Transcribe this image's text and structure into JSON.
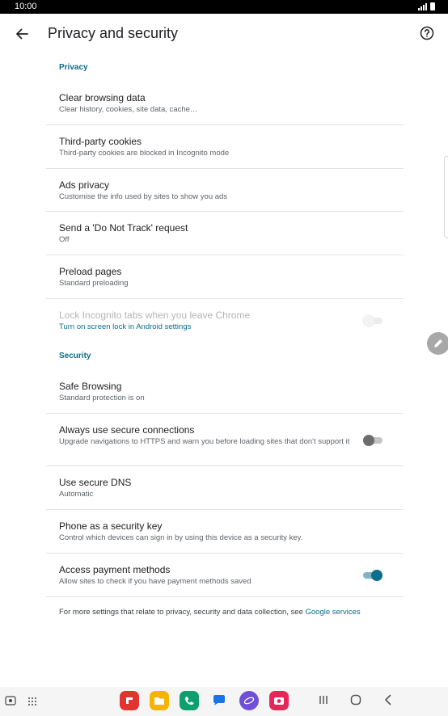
{
  "status_bar": {
    "time": "10:00"
  },
  "toolbar": {
    "title": "Privacy and security"
  },
  "sections": {
    "privacy_label": "Privacy",
    "security_label": "Security"
  },
  "rows": {
    "clear_browsing": {
      "title": "Clear browsing data",
      "subtitle": "Clear history, cookies, site data, cache…"
    },
    "third_party_cookies": {
      "title": "Third-party cookies",
      "subtitle": "Third-party cookies are blocked in Incognito mode"
    },
    "ads_privacy": {
      "title": "Ads privacy",
      "subtitle": "Customise the info used by sites to show you ads"
    },
    "do_not_track": {
      "title": "Send a 'Do Not Track' request",
      "subtitle": "Off"
    },
    "preload_pages": {
      "title": "Preload pages",
      "subtitle": "Standard preloading"
    },
    "lock_incognito": {
      "title": "Lock Incognito tabs when you leave Chrome",
      "subtitle": "Turn on screen lock in Android settings",
      "state": "off",
      "enabled": false
    },
    "safe_browsing": {
      "title": "Safe Browsing",
      "subtitle": "Standard protection is on"
    },
    "secure_connections": {
      "title": "Always use secure connections",
      "subtitle": "Upgrade navigations to HTTPS and warn you before loading sites that don't support it",
      "state": "off"
    },
    "secure_dns": {
      "title": "Use secure DNS",
      "subtitle": "Automatic"
    },
    "phone_security_key": {
      "title": "Phone as a security key",
      "subtitle": "Control which devices can sign in by using this device as a security key."
    },
    "payment_methods": {
      "title": "Access payment methods",
      "subtitle": "Allow sites to check if you have payment methods saved",
      "state": "on"
    }
  },
  "footer": {
    "text": "For more settings that relate to privacy, security and data collection, see ",
    "link": "Google services"
  },
  "icons": {
    "back": "arrow-left-icon",
    "help": "help-circle-icon",
    "edit": "pen-icon"
  },
  "dock_apps": [
    {
      "name": "flipboard-app-icon",
      "color": "#e0342f"
    },
    {
      "name": "files-app-icon",
      "color": "#f5b400"
    },
    {
      "name": "phone-app-icon",
      "color": "#0e9f6e"
    },
    {
      "name": "messages-app-icon",
      "color": "#1a73e8"
    },
    {
      "name": "internet-app-icon",
      "color": "#6f4fd8"
    },
    {
      "name": "camera-app-icon",
      "color": "#e8265a"
    }
  ],
  "colors": {
    "accent": "#0b6e8a"
  }
}
